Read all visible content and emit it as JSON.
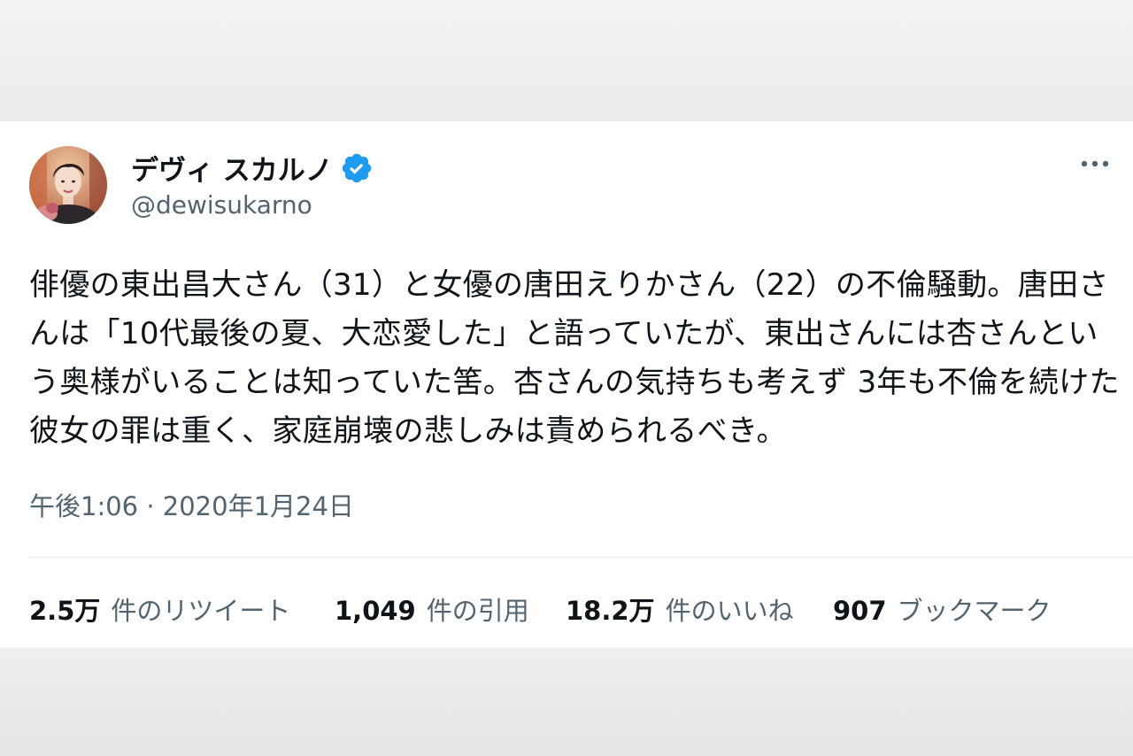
{
  "user": {
    "display_name": "デヴィ スカルノ",
    "handle": "@dewisukarno",
    "verified": true
  },
  "tweet": {
    "text": "俳優の東出昌大さん（31）と女優の唐田えりかさん（22）の不倫騒動。唐田さんは「10代最後の夏、大恋愛した」と語っていたが、東出さんには杏さんという奥様がいることは知っていた筈。杏さんの気持ちも考えず 3年も不倫を続けた彼女の罪は重く、家庭崩壊の悲しみは責められるべき。",
    "timestamp": "午後1:06 · 2020年1月24日"
  },
  "stats": {
    "retweets": {
      "value": "2.5万",
      "label": "件のリツイート"
    },
    "quotes": {
      "value": "1,049",
      "label": "件の引用"
    },
    "likes": {
      "value": "18.2万",
      "label": "件のいいね"
    },
    "bookmarks": {
      "value": "907",
      "label": "ブックマーク"
    }
  },
  "colors": {
    "verified_blue": "#1d9bf0",
    "text_primary": "#0f1419",
    "text_secondary": "#536471"
  },
  "icons": {
    "verified": "verified-badge-icon",
    "more": "more-options-icon"
  }
}
